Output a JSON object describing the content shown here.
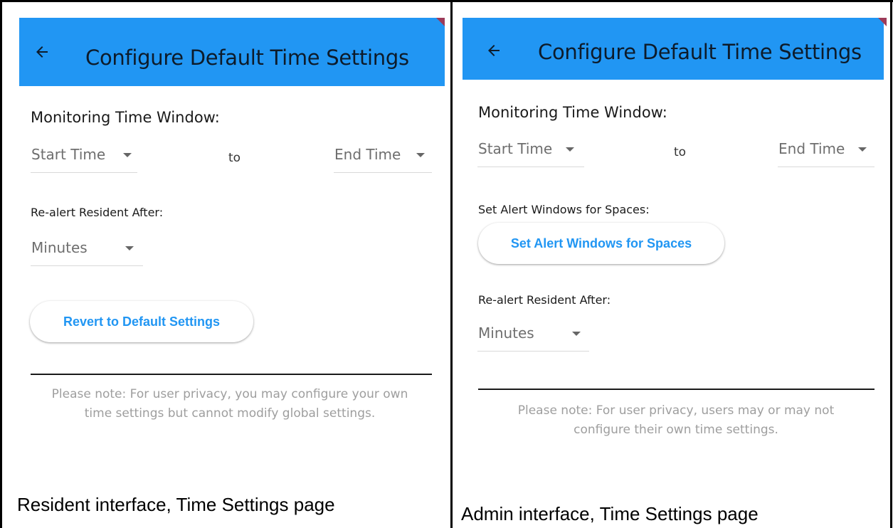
{
  "resident": {
    "appbar_title": "Configure Default Time Settings",
    "monitoring_label": "Monitoring Time Window:",
    "start_time": "Start Time",
    "to": "to",
    "end_time": "End Time",
    "realert_label": "Re-alert Resident After:",
    "minutes": "Minutes",
    "revert_button": "Revert to Default Settings",
    "note_line1": "Please note: For user privacy, you may configure your own",
    "note_line2": "time settings but cannot modify global settings.",
    "caption": "Resident interface, Time Settings page"
  },
  "admin": {
    "appbar_title": "Configure Default Time Settings",
    "monitoring_label": "Monitoring Time Window:",
    "start_time": "Start Time",
    "to": "to",
    "end_time": "End Time",
    "alert_windows_label": "Set Alert Windows for Spaces:",
    "alert_windows_button": "Set Alert Windows for Spaces",
    "realert_label": "Re-alert Resident After:",
    "minutes": "Minutes",
    "note_line1": "Please note: For user privacy, users may or may not",
    "note_line2": "configure their own time settings.",
    "caption": "Admin interface, Time Settings page"
  },
  "icons": {
    "back": "arrow-back-icon",
    "dropdown": "triangle-down-icon"
  },
  "colors": {
    "appbar": "#2196f3",
    "button_text": "#2196f3",
    "note_text": "#9e9e9e"
  }
}
